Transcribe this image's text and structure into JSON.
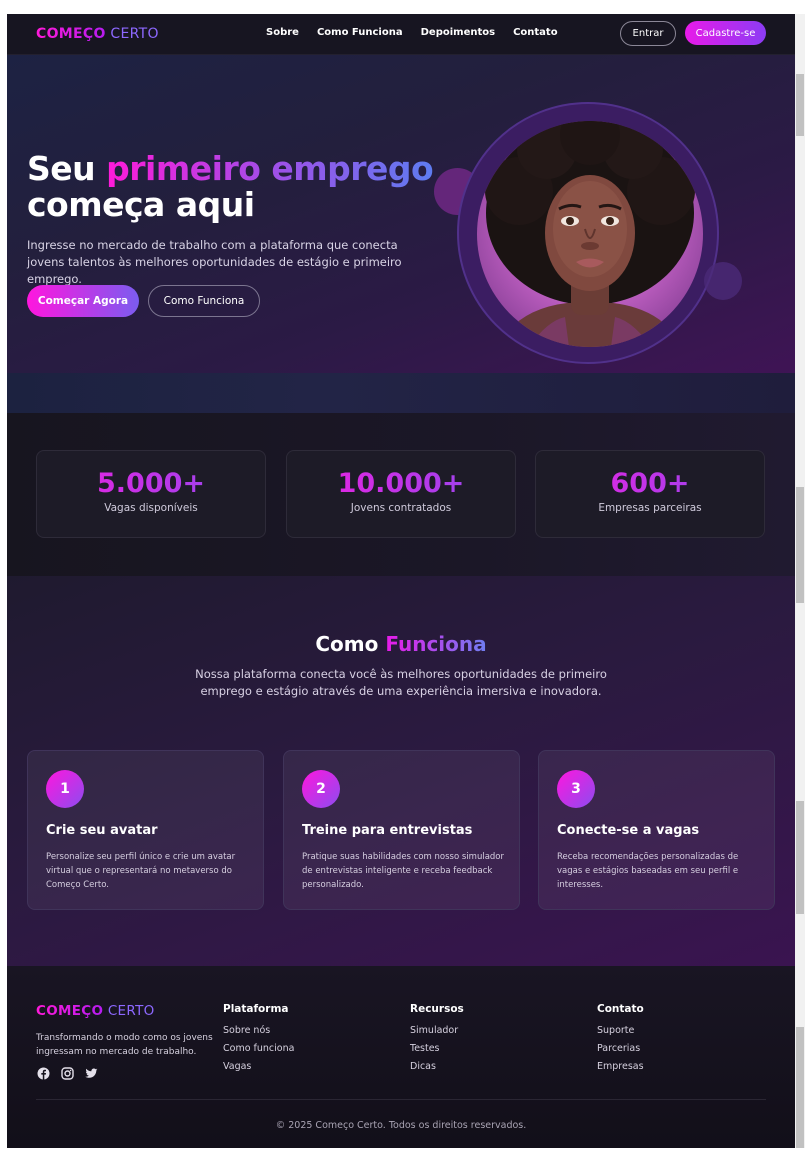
{
  "brand": {
    "name_bold": "COMEÇO",
    "name_light": "CERTO"
  },
  "nav": {
    "links": [
      "Sobre",
      "Como Funciona",
      "Depoimentos",
      "Contato"
    ],
    "login": "Entrar",
    "signup": "Cadastre-se"
  },
  "hero": {
    "title_line1_plain": "Seu",
    "title_line1_accent": "primeiro emprego",
    "title_line2": "começa aqui",
    "subtitle": "Ingresse no mercado de trabalho com a plataforma que conecta jovens talentos às melhores oportunidades de estágio e primeiro emprego.",
    "primary_button": "Começar Agora",
    "secondary_button": "Como Funciona"
  },
  "stats": [
    {
      "value": "5.000+",
      "label": "Vagas disponíveis"
    },
    {
      "value": "10.000+",
      "label": "Jovens contratados"
    },
    {
      "value": "600+",
      "label": "Empresas parceiras"
    }
  ],
  "how": {
    "title_plain": "Como",
    "title_accent": "Funciona",
    "subtitle": "Nossa plataforma conecta você às melhores oportunidades de primeiro emprego e estágio através de uma experiência imersiva e inovadora.",
    "steps": [
      {
        "number": "1",
        "title": "Crie seu avatar",
        "text": "Personalize seu perfil único e crie um avatar virtual que o representará no metaverso do Começo Certo."
      },
      {
        "number": "2",
        "title": "Treine para entrevistas",
        "text": "Pratique suas habilidades com nosso simulador de entrevistas inteligente e receba feedback personalizado."
      },
      {
        "number": "3",
        "title": "Conecte-se a vagas",
        "text": "Receba recomendações personalizadas de vagas e estágios baseadas em seu perfil e interesses."
      }
    ]
  },
  "footer": {
    "description": "Transformando o modo como os jovens ingressam no mercado de trabalho.",
    "socials": [
      "facebook-icon",
      "instagram-icon",
      "twitter-icon"
    ],
    "columns": [
      {
        "heading": "Plataforma",
        "links": [
          "Sobre nós",
          "Como funciona",
          "Vagas"
        ]
      },
      {
        "heading": "Recursos",
        "links": [
          "Simulador",
          "Testes",
          "Dicas"
        ]
      },
      {
        "heading": "Contato",
        "links": [
          "Suporte",
          "Parcerias",
          "Empresas"
        ]
      }
    ],
    "copyright": "© 2025 Começo Certo. Todos os direitos reservados."
  },
  "colors": {
    "accent_pink": "#ff1ad9",
    "accent_purple": "#8c4cf0",
    "background": "#15131f"
  }
}
